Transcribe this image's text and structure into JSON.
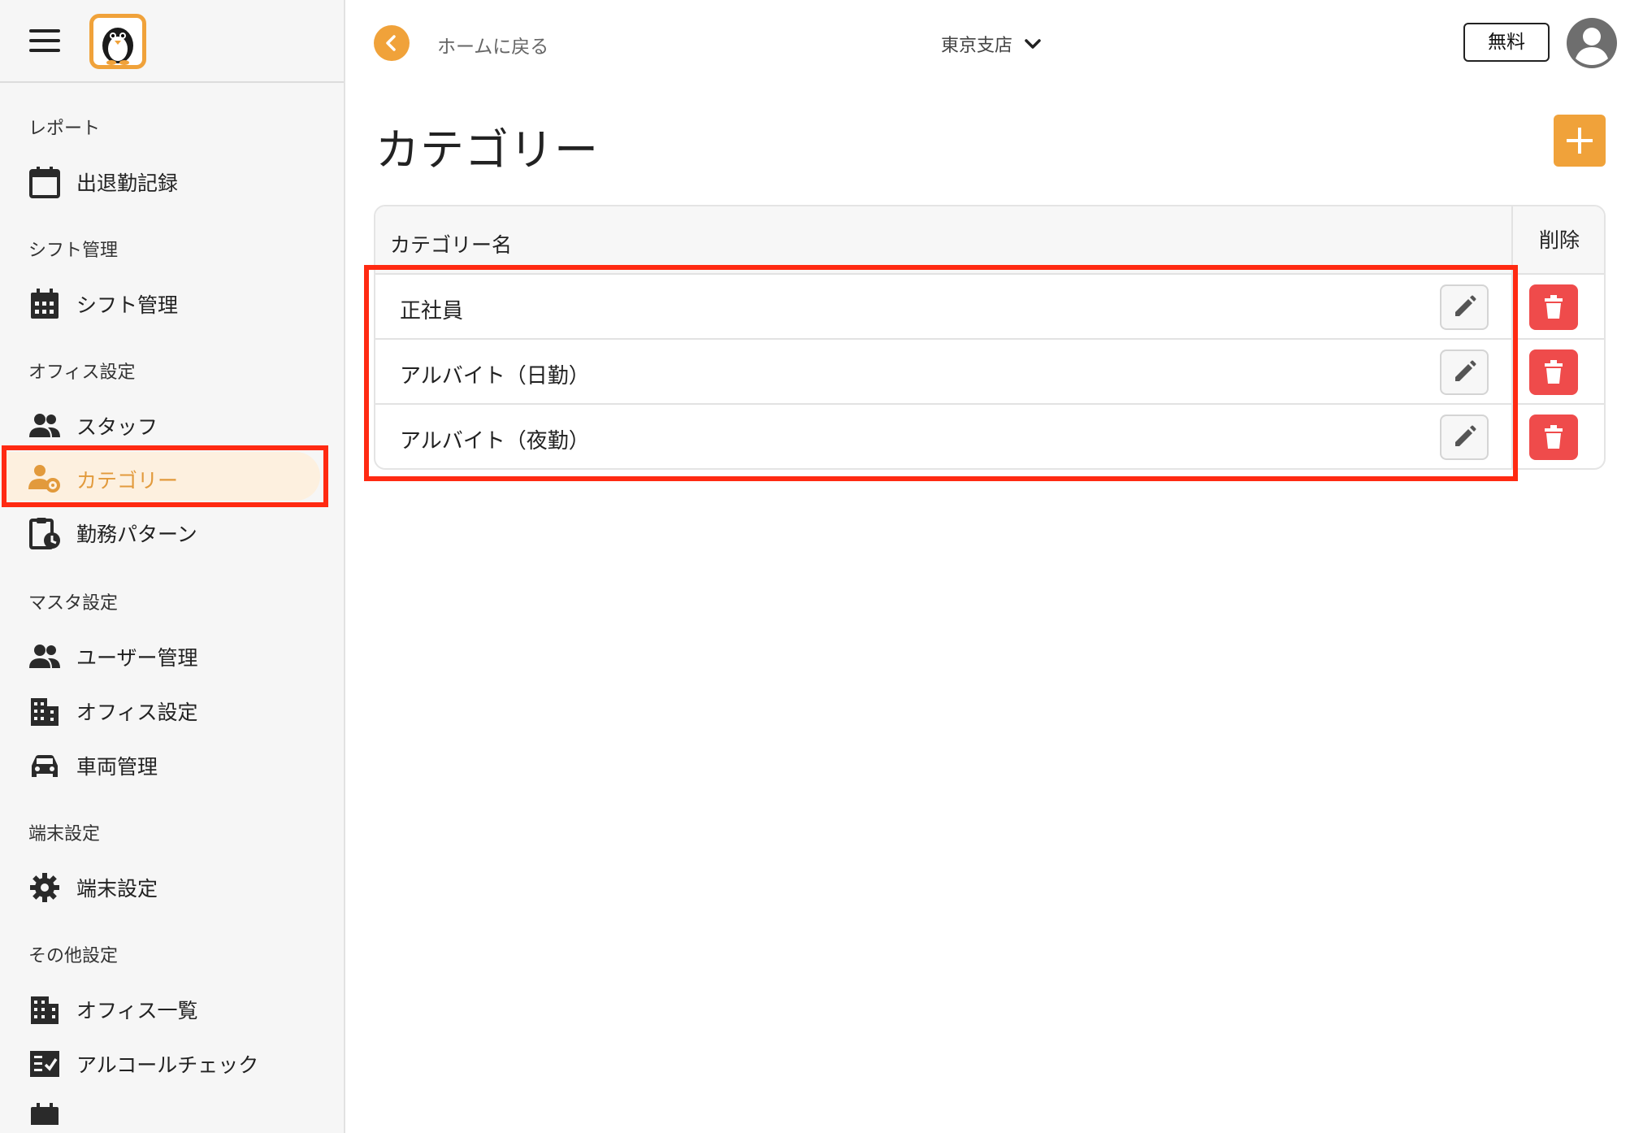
{
  "header": {
    "back_label": "ホームに戻る",
    "branch": "東京支店",
    "plan": "無料"
  },
  "sidebar": {
    "sections": [
      {
        "title": "レポート",
        "items": [
          {
            "label": "出退勤記録",
            "icon": "calendar-icon"
          }
        ]
      },
      {
        "title": "シフト管理",
        "items": [
          {
            "label": "シフト管理",
            "icon": "calendar-grid-icon"
          }
        ]
      },
      {
        "title": "オフィス設定",
        "items": [
          {
            "label": "スタッフ",
            "icon": "people-icon"
          },
          {
            "label": "カテゴリー",
            "icon": "user-gear-icon",
            "active": true
          },
          {
            "label": "勤務パターン",
            "icon": "clipboard-clock-icon"
          }
        ]
      },
      {
        "title": "マスタ設定",
        "items": [
          {
            "label": "ユーザー管理",
            "icon": "people-icon"
          },
          {
            "label": "オフィス設定",
            "icon": "building-icon"
          },
          {
            "label": "車両管理",
            "icon": "car-icon"
          }
        ]
      },
      {
        "title": "端末設定",
        "items": [
          {
            "label": "端末設定",
            "icon": "gear-icon"
          }
        ]
      },
      {
        "title": "その他設定",
        "items": [
          {
            "label": "オフィス一覧",
            "icon": "building-list-icon"
          },
          {
            "label": "アルコールチェック",
            "icon": "checklist-icon"
          }
        ]
      }
    ]
  },
  "main": {
    "title": "カテゴリー",
    "table": {
      "columns": [
        "カテゴリー名",
        "削除"
      ],
      "rows": [
        {
          "name": "正社員"
        },
        {
          "name": "アルバイト（日勤）"
        },
        {
          "name": "アルバイト（夜勤）"
        }
      ]
    }
  },
  "colors": {
    "accent": "#f0a23a",
    "danger": "#ef4b4b",
    "highlight": "#ff2a12",
    "active_bg": "#fdf0df"
  }
}
